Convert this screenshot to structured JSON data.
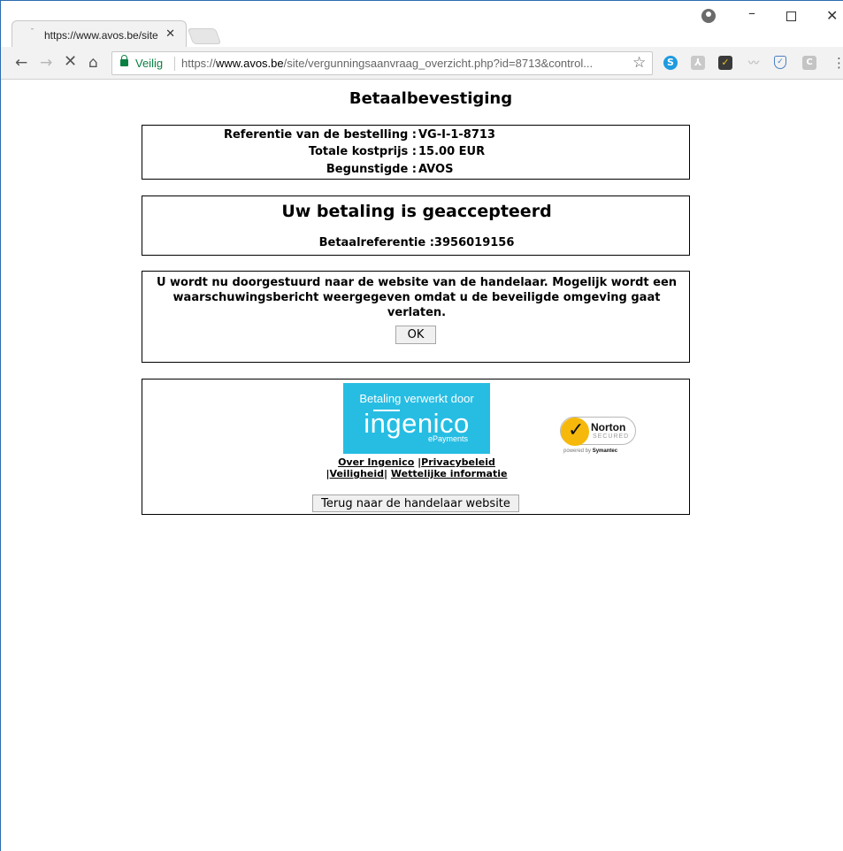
{
  "browser": {
    "tab_title": "https://www.avos.be/site",
    "tab_favicon": "loading-icon",
    "tab_close": "✕",
    "secure_label": "Veilig",
    "url_scheme": "https://",
    "url_host": "www.avos.be",
    "url_path": "/site/vergunningsaanvraag_overzicht.php?id=8713&control...",
    "star": "☆",
    "extensions": {
      "skype": "S",
      "pdf": "⅄",
      "tick": "✓",
      "wifi": "〰",
      "shield": "✓",
      "c": "C"
    },
    "window_controls": {
      "minimize": "–",
      "close": "✕"
    },
    "nav": {
      "back": "←",
      "forward": "→",
      "stop": "✕",
      "home": "⌂",
      "menu": "⋮"
    }
  },
  "page": {
    "title": "Betaalbevestiging",
    "summary": [
      {
        "label": "Referentie van de bestelling :",
        "value": "VG-I-1-8713"
      },
      {
        "label": "Totale kostprijs :",
        "value": "15.00 EUR"
      },
      {
        "label": "Begunstigde :",
        "value": "AVOS"
      }
    ],
    "accepted_title": "Uw betaling is geaccepteerd",
    "payment_reference": "Betaalreferentie :3956019156",
    "redirect_text": "U wordt nu doorgestuurd naar de website van de handelaar. Mogelijk wordt een waarschuwingsbericht weergegeven omdat u de beveiligde omgeving gaat verlaten.",
    "ok_button": "OK",
    "ingenico": {
      "caption": "Betaling verwerkt door",
      "name": "ingenico",
      "sub": "ePayments"
    },
    "norton": {
      "name": "Norton",
      "secured": "SECURED",
      "powered_prefix": "powered by",
      "powered_brand": "Symantec"
    },
    "links": {
      "about": "Over Ingenico",
      "privacy": "Privacybeleid",
      "security": "Veiligheid",
      "legal": "Wettelijke informatie",
      "sep": "|"
    },
    "back_button": "Terug naar de handelaar website"
  },
  "colors": {
    "secure_green": "#0b8043",
    "ingenico_blue": "#27bde3",
    "norton_yellow": "#f6b90b"
  }
}
